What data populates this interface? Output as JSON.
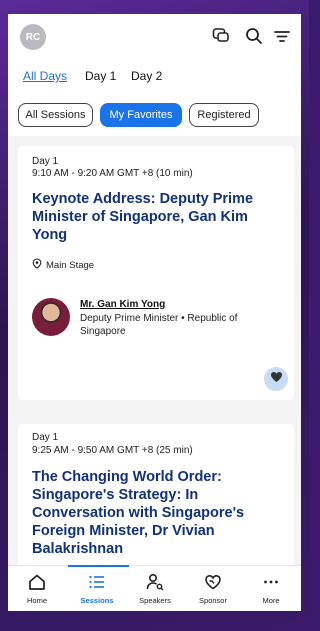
{
  "header": {
    "avatar_initials": "RC"
  },
  "day_tabs": [
    {
      "label": "All Days",
      "active": true
    },
    {
      "label": "Day 1",
      "active": false
    },
    {
      "label": "Day 2",
      "active": false
    }
  ],
  "filters": [
    {
      "label": "All Sessions",
      "active": false
    },
    {
      "label": "My Favorites",
      "active": true
    },
    {
      "label": "Registered",
      "active": false
    }
  ],
  "sessions": [
    {
      "day": "Day 1",
      "time": "9:10 AM - 9:20 AM GMT +8  (10 min)",
      "title": "Keynote Address: Deputy Prime Minister of Singapore, Gan Kim Yong",
      "location": "Main Stage",
      "speaker_name": "Mr. Gan Kim Yong",
      "speaker_role": "Deputy Prime Minister • Republic of Singapore",
      "favorited": true
    },
    {
      "day": "Day 1",
      "time": "9:25 AM - 9:50 AM GMT +8  (25 min)",
      "title": "The Changing World Order: Singapore's Strategy: In Conversation with Singapore's Foreign Minister, Dr Vivian Balakrishnan"
    }
  ],
  "bottom_nav": [
    {
      "label": "Home",
      "icon": "home-icon"
    },
    {
      "label": "Sessions",
      "icon": "list-icon",
      "active": true
    },
    {
      "label": "Speakers",
      "icon": "speakers-icon"
    },
    {
      "label": "Sponsor",
      "icon": "sponsor-icon"
    },
    {
      "label": "More",
      "icon": "more-icon"
    }
  ],
  "colors": {
    "accent": "#1a73e8",
    "title": "#11317c",
    "favorite_bg": "#c9dcf5"
  }
}
